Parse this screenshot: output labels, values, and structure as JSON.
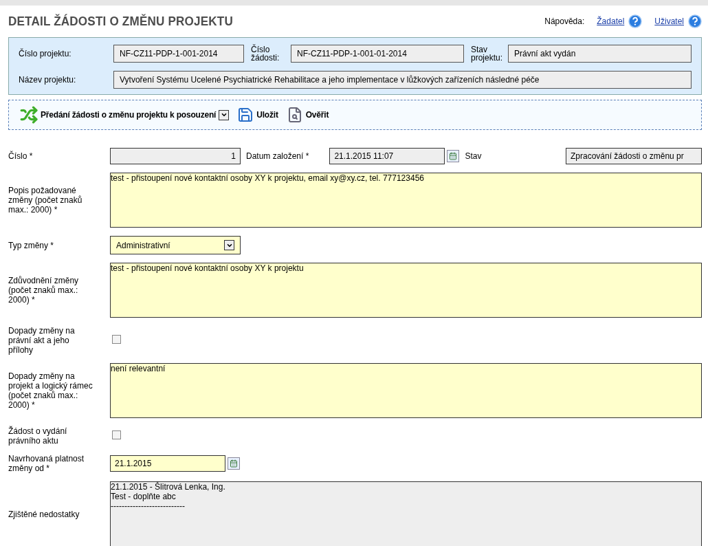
{
  "header": {
    "title": "DETAIL ŽÁDOSTI O ZMĚNU PROJEKTU",
    "help_label": "Nápověda:",
    "help_links": [
      "Žadatel",
      "Uživatel"
    ]
  },
  "project": {
    "fields": [
      {
        "label": "Číslo projektu:",
        "value": "NF-CZ11-PDP-1-001-2014"
      },
      {
        "label": "Číslo žádosti:",
        "value": "NF-CZ11-PDP-1-001-01-2014"
      },
      {
        "label": "Stav projektu:",
        "value": "Právní akt vydán"
      }
    ],
    "name": {
      "label": "Název projektu:",
      "value": "Vytvoření Systému Ucelené Psychiatrické Rehabilitace a jeho implementace v lůžkových zařízeních následné péče"
    }
  },
  "toolbar": [
    {
      "kind": "dropdown",
      "label": "Předání žádosti o změnu projektu k posouzení"
    },
    {
      "kind": "save",
      "label": "Uložit"
    },
    {
      "kind": "verify",
      "label": "Ověřit"
    }
  ],
  "form": [
    {
      "kind": "numbers",
      "label": "Číslo *",
      "value": "1",
      "date_label": "Datum založení *",
      "date": "21.1.2015 11:07",
      "state_label": "Stav",
      "state": "Zpracování žádosti o změnu pr"
    },
    {
      "kind": "textarea",
      "label": "Popis požadované změny (počet znaků max.: 2000) *",
      "value": "test - přistoupení nové kontaktní osoby XY k projektu, email xy@xy.cz, tel. 777123456",
      "readonly": false
    },
    {
      "kind": "select",
      "label": "Typ změny *",
      "value": "Administrativní"
    },
    {
      "kind": "textarea",
      "label": "Zdůvodnění změny (počet znaků max.: 2000) *",
      "value": "test - přistoupení nové kontaktní osoby XY k projektu",
      "readonly": false
    },
    {
      "kind": "checkbox",
      "label": "Dopady změny na právní akt a jeho přílohy",
      "checked": false
    },
    {
      "kind": "textarea",
      "label": "Dopady změny na projekt a logický rámec (počet znaků max.: 2000) *",
      "value": "není relevantní",
      "readonly": false
    },
    {
      "kind": "checkbox",
      "label": "Žádost o vydání právního aktu",
      "checked": false
    },
    {
      "kind": "date",
      "label": "Navrhovaná platnost změny od *",
      "value": "21.1.2015"
    },
    {
      "kind": "textarea",
      "label": "Zjištěné nedostatky",
      "value": "21.1.2015 - Šlitrová Lenka, Ing.\nTest - doplňte abc\n---------------------------",
      "readonly": true
    }
  ]
}
